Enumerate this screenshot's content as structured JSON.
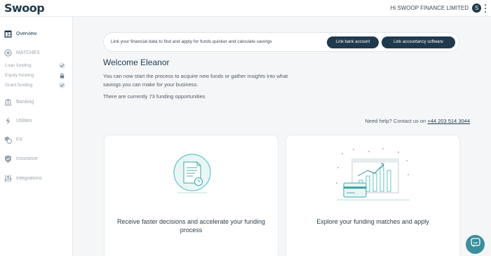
{
  "header": {
    "logo": "Swoop",
    "greeting": "Hi SWOOP FINANCE LIMITED",
    "avatar_initial": "S"
  },
  "sidebar": {
    "items": [
      {
        "label": "Overview",
        "icon": "overview-icon",
        "active": true
      },
      {
        "label": "MATCHES",
        "icon": "matches-icon",
        "active": false
      }
    ],
    "sub_items": [
      {
        "label": "Loan funding",
        "status": "check-icon"
      },
      {
        "label": "Equity funding",
        "status": "lock-icon"
      },
      {
        "label": "Grant funding",
        "status": "check-icon"
      }
    ],
    "more_items": [
      {
        "label": "Banking",
        "icon": "bank-icon"
      },
      {
        "label": "Utilities",
        "icon": "lightning-icon"
      },
      {
        "label": "FX",
        "icon": "fx-icon"
      },
      {
        "label": "Insurance",
        "icon": "shield-icon"
      },
      {
        "label": "Integrations",
        "icon": "sliders-icon"
      }
    ]
  },
  "banner": {
    "text": "Link your financial data to find and apply for funds quicker and calculate savings",
    "link_bank_label": "Link bank account",
    "link_accountancy_label": "Link accountancy software"
  },
  "main": {
    "welcome": "Welcome Eleanor",
    "intro": "You can now start the process to acquire new funds or gather insights into what savings you can make for your business.",
    "opportunities": "There are currently 73 funding opportunities",
    "help_prefix": "Need help? Contact us on",
    "help_phone": "+44 203 514 3044"
  },
  "cards": [
    {
      "title": "Receive faster decisions and accelerate your funding process",
      "icon": "document-icon"
    },
    {
      "title": "Explore your funding matches and apply",
      "icon": "chart-card-icon"
    }
  ],
  "colors": {
    "brand": "#1f3a4d",
    "accent": "#3aa8a8",
    "background": "#f5f6f8"
  }
}
